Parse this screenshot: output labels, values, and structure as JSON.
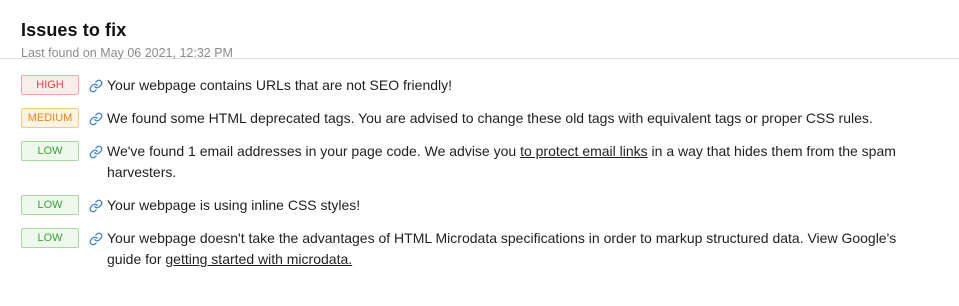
{
  "header": {
    "title": "Issues to fix",
    "last_found": "Last found on May 06 2021, 12:32 PM"
  },
  "issues": [
    {
      "severity": "HIGH",
      "level": "high",
      "icon": "link-icon",
      "text": "Your webpage contains URLs that are not SEO friendly!"
    },
    {
      "severity": "MEDIUM",
      "level": "medium",
      "icon": "link-icon",
      "text": "We found some HTML deprecated tags. You are advised to change these old tags with equivalent tags or proper CSS rules."
    },
    {
      "severity": "LOW",
      "level": "low",
      "icon": "link-icon",
      "text_before": "We've found 1 email addresses in your page code. We advise you ",
      "link": "to protect email links",
      "text_after": "  in a way that hides them from the spam harvesters."
    },
    {
      "severity": "LOW",
      "level": "low",
      "icon": "link-icon",
      "text": "Your webpage is using inline CSS styles!"
    },
    {
      "severity": "LOW",
      "level": "low",
      "icon": "link-icon",
      "text_before": "Your webpage doesn't take the advantages of HTML Microdata specifications in order to markup structured data. View Google's guide for ",
      "link": "getting started with microdata.",
      "text_after": ""
    }
  ],
  "colors": {
    "high": "#e0404a",
    "medium": "#e08a1f",
    "low": "#3aa037",
    "link_icon": "#3b82c4"
  }
}
